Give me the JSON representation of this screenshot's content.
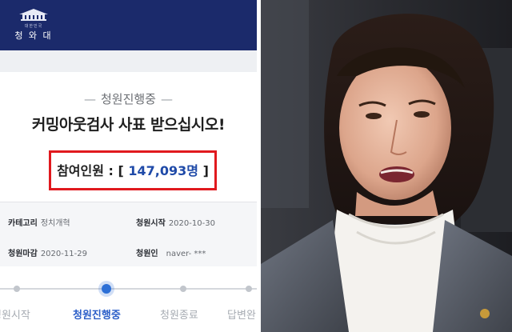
{
  "header": {
    "logo_sub": "대한민국",
    "logo_main": "청 와 대"
  },
  "petition": {
    "status": "청원진행중",
    "title": "커밍아웃검사 사표 받으십시오!",
    "participants_label": "참여인원",
    "participants_value": "147,093",
    "participants_unit": "명"
  },
  "info": {
    "category_label": "카테고리",
    "category_value": "정치개혁",
    "start_label": "청원시작",
    "start_value": "2020-10-30",
    "end_label": "청원마감",
    "end_value": "2020-11-29",
    "author_label": "청원인",
    "author_value": "naver- ***"
  },
  "progress": {
    "steps": [
      "청원시작",
      "청원진행중",
      "청원종료",
      "답변완"
    ],
    "active_index": 1
  },
  "colors": {
    "header_navy": "#1b2a6b",
    "highlight_red": "#e0191e",
    "count_blue": "#1f4aa8",
    "active_step_blue": "#2c6fd6"
  }
}
